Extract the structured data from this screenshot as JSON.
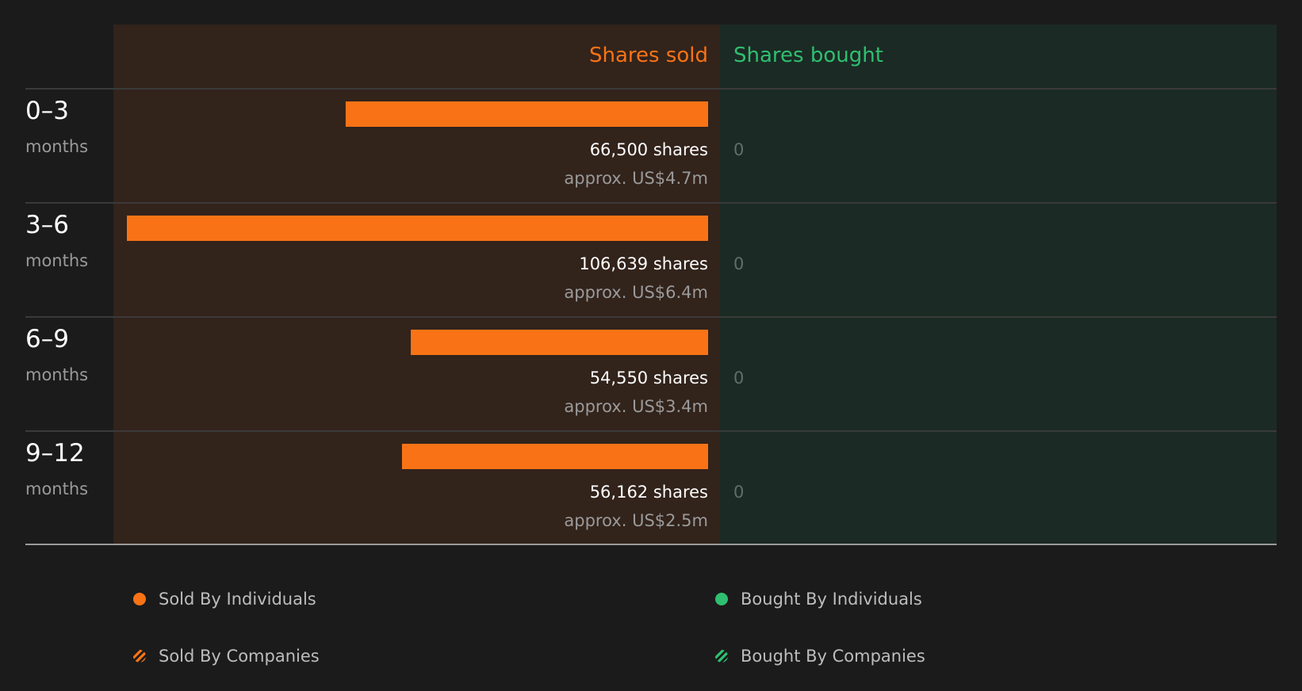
{
  "chart_data": {
    "type": "bar",
    "column_headers": {
      "sold": "Shares sold",
      "bought": "Shares bought"
    },
    "categories": [
      {
        "range": "0–3",
        "unit": "months"
      },
      {
        "range": "3–6",
        "unit": "months"
      },
      {
        "range": "6–9",
        "unit": "months"
      },
      {
        "range": "9–12",
        "unit": "months"
      }
    ],
    "series": [
      {
        "name": "Sold By Individuals",
        "values": [
          66500,
          106639,
          54550,
          56162
        ],
        "labels": [
          "66,500 shares",
          "106,639 shares",
          "54,550 shares",
          "56,162 shares"
        ],
        "sublabels": [
          "approx. US$4.7m",
          "approx. US$6.4m",
          "approx. US$3.4m",
          "approx. US$2.5m"
        ]
      },
      {
        "name": "Bought By Individuals",
        "values": [
          0,
          0,
          0,
          0
        ],
        "labels": [
          "0",
          "0",
          "0",
          "0"
        ]
      }
    ],
    "legend": [
      {
        "label": "Sold By Individuals",
        "marker": "dot",
        "color": "#f97316"
      },
      {
        "label": "Bought By Individuals",
        "marker": "dot",
        "color": "#2fbf71"
      },
      {
        "label": "Sold By Companies",
        "marker": "hatched-dot",
        "color": "#f97316"
      },
      {
        "label": "Bought By Companies",
        "marker": "hatched-dot",
        "color": "#2fbf71"
      }
    ],
    "legend_position": "bottom",
    "colors": {
      "page_bg": "#1b1b1b",
      "sold_panel_bg": "#32231b",
      "bought_panel_bg": "#1b2a24",
      "sold_accent": "#f97316",
      "bought_accent": "#2fbf71",
      "primary_text": "#ffffff",
      "secondary_text": "#9a9a9a",
      "zero_text": "#5d7068",
      "divider": "#3a3a3a",
      "baseline": "#9a9a9a"
    }
  }
}
